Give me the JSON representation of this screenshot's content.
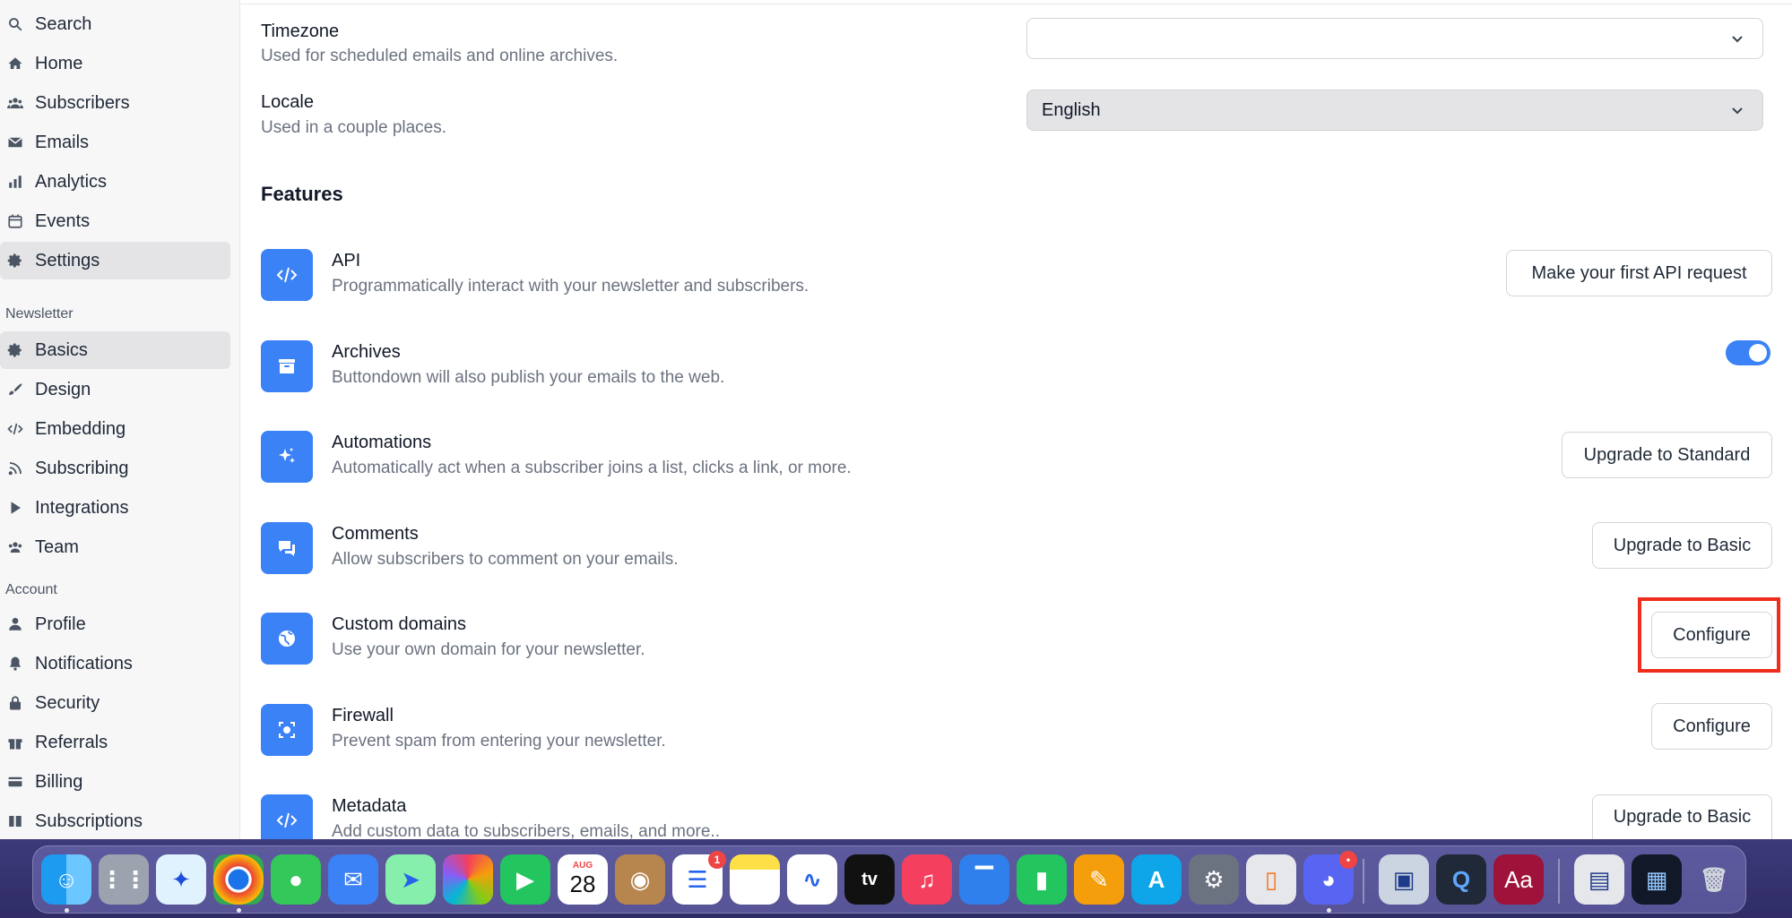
{
  "sidebar": {
    "main_items": [
      {
        "label": "Search",
        "icon": "search-icon"
      },
      {
        "label": "Home",
        "icon": "home-icon"
      },
      {
        "label": "Subscribers",
        "icon": "users-icon"
      },
      {
        "label": "Emails",
        "icon": "envelope-icon"
      },
      {
        "label": "Analytics",
        "icon": "bar-chart-icon"
      },
      {
        "label": "Events",
        "icon": "calendar-icon"
      },
      {
        "label": "Settings",
        "icon": "gear-icon"
      }
    ],
    "newsletter_label": "Newsletter",
    "newsletter_items": [
      {
        "label": "Basics",
        "icon": "gear-icon"
      },
      {
        "label": "Design",
        "icon": "brush-icon"
      },
      {
        "label": "Embedding",
        "icon": "code-icon"
      },
      {
        "label": "Subscribing",
        "icon": "rss-icon"
      },
      {
        "label": "Integrations",
        "icon": "play-icon"
      },
      {
        "label": "Team",
        "icon": "users-icon"
      }
    ],
    "account_label": "Account",
    "account_items": [
      {
        "label": "Profile",
        "icon": "person-icon"
      },
      {
        "label": "Notifications",
        "icon": "bell-icon"
      },
      {
        "label": "Security",
        "icon": "lock-icon"
      },
      {
        "label": "Referrals",
        "icon": "gift-icon"
      },
      {
        "label": "Billing",
        "icon": "credit-card-icon"
      },
      {
        "label": "Subscriptions",
        "icon": "columns-icon"
      }
    ]
  },
  "settings": {
    "timezone": {
      "title": "Timezone",
      "desc": "Used for scheduled emails and online archives.",
      "value": ""
    },
    "locale": {
      "title": "Locale",
      "desc": "Used in a couple places.",
      "value": "English"
    }
  },
  "features": {
    "heading": "Features",
    "items": [
      {
        "name": "API",
        "desc": "Programmatically interact with your newsletter and subscribers.",
        "action": "Make your first API request",
        "icon": "code-icon"
      },
      {
        "name": "Archives",
        "desc": "Buttondown will also publish your emails to the web.",
        "action": "",
        "toggle_on": true,
        "icon": "archive-icon"
      },
      {
        "name": "Automations",
        "desc": "Automatically act when a subscriber joins a list, clicks a link, or more.",
        "action": "Upgrade to Standard",
        "icon": "sparkles-icon"
      },
      {
        "name": "Comments",
        "desc": "Allow subscribers to comment on your emails.",
        "action": "Upgrade to Basic",
        "icon": "comments-icon"
      },
      {
        "name": "Custom domains",
        "desc": "Use your own domain for your newsletter.",
        "action": "Configure",
        "icon": "globe-icon"
      },
      {
        "name": "Firewall",
        "desc": "Prevent spam from entering your newsletter.",
        "action": "Configure",
        "icon": "scan-icon"
      },
      {
        "name": "Metadata",
        "desc": "Add custom data to subscribers, emails, and more..",
        "action": "Upgrade to Basic",
        "icon": "code-icon"
      }
    ]
  },
  "dock": {
    "calendar_month": "AUG",
    "calendar_day": "28",
    "reminders_badge": "1",
    "discord_badge": "•",
    "appletv_label": "tv",
    "dictionary_label": "Aa",
    "colors": {
      "accent": "#3b82f6",
      "highlight": "#ef2d1d"
    }
  }
}
